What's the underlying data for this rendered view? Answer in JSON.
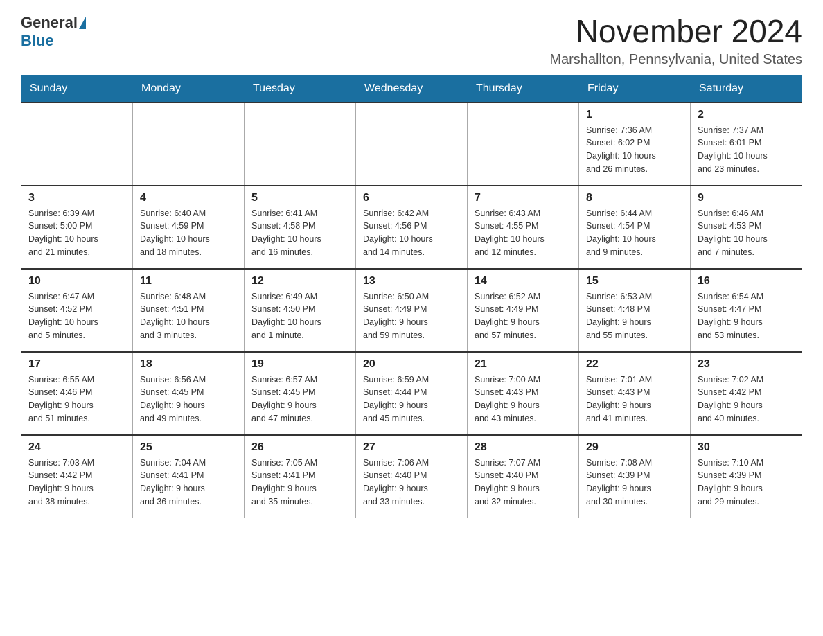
{
  "header": {
    "logo_general": "General",
    "logo_blue": "Blue",
    "title": "November 2024",
    "subtitle": "Marshallton, Pennsylvania, United States"
  },
  "days_of_week": [
    "Sunday",
    "Monday",
    "Tuesday",
    "Wednesday",
    "Thursday",
    "Friday",
    "Saturday"
  ],
  "weeks": [
    [
      {
        "day": "",
        "info": ""
      },
      {
        "day": "",
        "info": ""
      },
      {
        "day": "",
        "info": ""
      },
      {
        "day": "",
        "info": ""
      },
      {
        "day": "",
        "info": ""
      },
      {
        "day": "1",
        "info": "Sunrise: 7:36 AM\nSunset: 6:02 PM\nDaylight: 10 hours\nand 26 minutes."
      },
      {
        "day": "2",
        "info": "Sunrise: 7:37 AM\nSunset: 6:01 PM\nDaylight: 10 hours\nand 23 minutes."
      }
    ],
    [
      {
        "day": "3",
        "info": "Sunrise: 6:39 AM\nSunset: 5:00 PM\nDaylight: 10 hours\nand 21 minutes."
      },
      {
        "day": "4",
        "info": "Sunrise: 6:40 AM\nSunset: 4:59 PM\nDaylight: 10 hours\nand 18 minutes."
      },
      {
        "day": "5",
        "info": "Sunrise: 6:41 AM\nSunset: 4:58 PM\nDaylight: 10 hours\nand 16 minutes."
      },
      {
        "day": "6",
        "info": "Sunrise: 6:42 AM\nSunset: 4:56 PM\nDaylight: 10 hours\nand 14 minutes."
      },
      {
        "day": "7",
        "info": "Sunrise: 6:43 AM\nSunset: 4:55 PM\nDaylight: 10 hours\nand 12 minutes."
      },
      {
        "day": "8",
        "info": "Sunrise: 6:44 AM\nSunset: 4:54 PM\nDaylight: 10 hours\nand 9 minutes."
      },
      {
        "day": "9",
        "info": "Sunrise: 6:46 AM\nSunset: 4:53 PM\nDaylight: 10 hours\nand 7 minutes."
      }
    ],
    [
      {
        "day": "10",
        "info": "Sunrise: 6:47 AM\nSunset: 4:52 PM\nDaylight: 10 hours\nand 5 minutes."
      },
      {
        "day": "11",
        "info": "Sunrise: 6:48 AM\nSunset: 4:51 PM\nDaylight: 10 hours\nand 3 minutes."
      },
      {
        "day": "12",
        "info": "Sunrise: 6:49 AM\nSunset: 4:50 PM\nDaylight: 10 hours\nand 1 minute."
      },
      {
        "day": "13",
        "info": "Sunrise: 6:50 AM\nSunset: 4:49 PM\nDaylight: 9 hours\nand 59 minutes."
      },
      {
        "day": "14",
        "info": "Sunrise: 6:52 AM\nSunset: 4:49 PM\nDaylight: 9 hours\nand 57 minutes."
      },
      {
        "day": "15",
        "info": "Sunrise: 6:53 AM\nSunset: 4:48 PM\nDaylight: 9 hours\nand 55 minutes."
      },
      {
        "day": "16",
        "info": "Sunrise: 6:54 AM\nSunset: 4:47 PM\nDaylight: 9 hours\nand 53 minutes."
      }
    ],
    [
      {
        "day": "17",
        "info": "Sunrise: 6:55 AM\nSunset: 4:46 PM\nDaylight: 9 hours\nand 51 minutes."
      },
      {
        "day": "18",
        "info": "Sunrise: 6:56 AM\nSunset: 4:45 PM\nDaylight: 9 hours\nand 49 minutes."
      },
      {
        "day": "19",
        "info": "Sunrise: 6:57 AM\nSunset: 4:45 PM\nDaylight: 9 hours\nand 47 minutes."
      },
      {
        "day": "20",
        "info": "Sunrise: 6:59 AM\nSunset: 4:44 PM\nDaylight: 9 hours\nand 45 minutes."
      },
      {
        "day": "21",
        "info": "Sunrise: 7:00 AM\nSunset: 4:43 PM\nDaylight: 9 hours\nand 43 minutes."
      },
      {
        "day": "22",
        "info": "Sunrise: 7:01 AM\nSunset: 4:43 PM\nDaylight: 9 hours\nand 41 minutes."
      },
      {
        "day": "23",
        "info": "Sunrise: 7:02 AM\nSunset: 4:42 PM\nDaylight: 9 hours\nand 40 minutes."
      }
    ],
    [
      {
        "day": "24",
        "info": "Sunrise: 7:03 AM\nSunset: 4:42 PM\nDaylight: 9 hours\nand 38 minutes."
      },
      {
        "day": "25",
        "info": "Sunrise: 7:04 AM\nSunset: 4:41 PM\nDaylight: 9 hours\nand 36 minutes."
      },
      {
        "day": "26",
        "info": "Sunrise: 7:05 AM\nSunset: 4:41 PM\nDaylight: 9 hours\nand 35 minutes."
      },
      {
        "day": "27",
        "info": "Sunrise: 7:06 AM\nSunset: 4:40 PM\nDaylight: 9 hours\nand 33 minutes."
      },
      {
        "day": "28",
        "info": "Sunrise: 7:07 AM\nSunset: 4:40 PM\nDaylight: 9 hours\nand 32 minutes."
      },
      {
        "day": "29",
        "info": "Sunrise: 7:08 AM\nSunset: 4:39 PM\nDaylight: 9 hours\nand 30 minutes."
      },
      {
        "day": "30",
        "info": "Sunrise: 7:10 AM\nSunset: 4:39 PM\nDaylight: 9 hours\nand 29 minutes."
      }
    ]
  ]
}
